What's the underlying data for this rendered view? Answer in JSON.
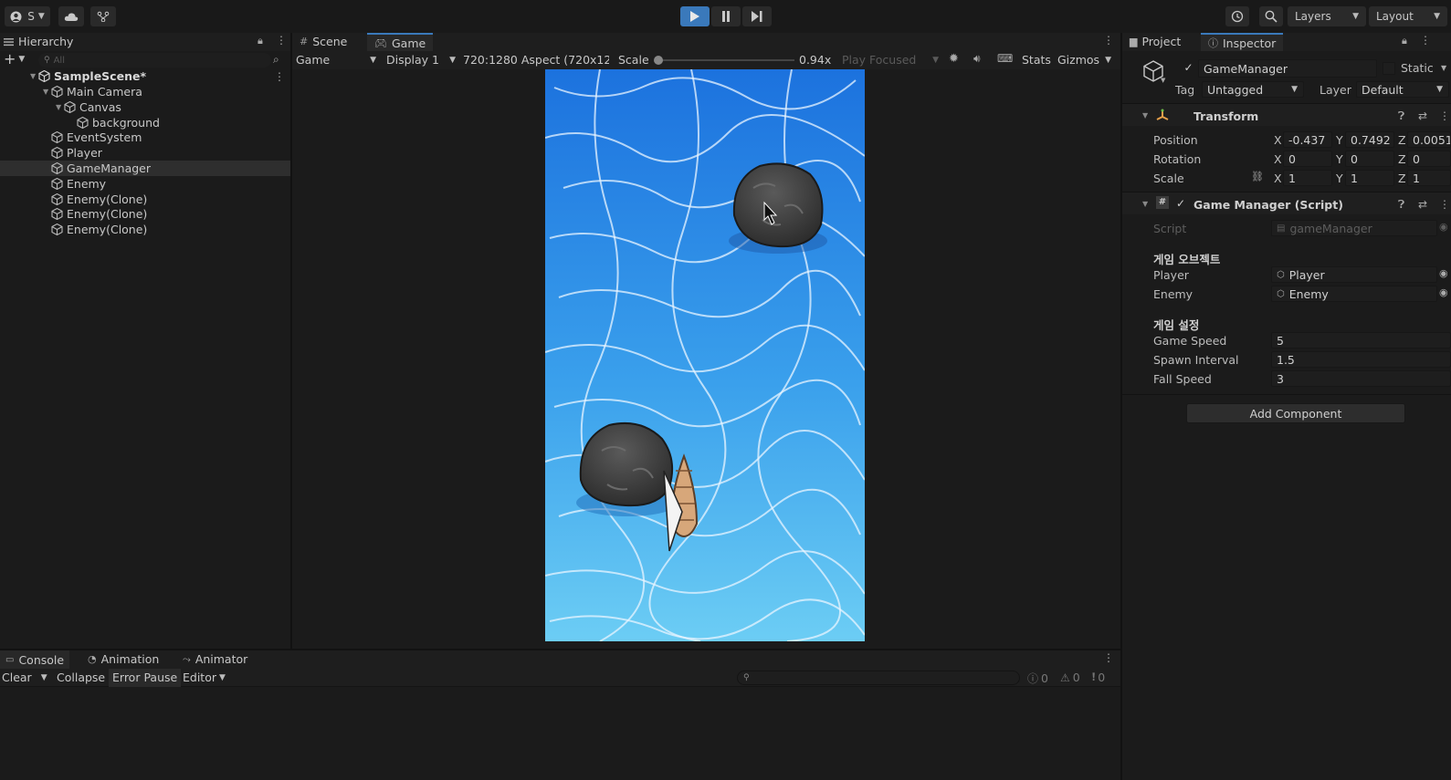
{
  "toolbar": {
    "account_label": "S",
    "layers_label": "Layers",
    "layout_label": "Layout",
    "play_color": "#3a79bb"
  },
  "hierarchy": {
    "tab_label": "Hierarchy",
    "search_placeholder": "All",
    "scene_name": "SampleScene*",
    "items": [
      {
        "label": "Main Camera",
        "indent": 1,
        "expanded": true
      },
      {
        "label": "Canvas",
        "indent": 2,
        "expanded": true
      },
      {
        "label": "background",
        "indent": 3
      },
      {
        "label": "EventSystem",
        "indent": 1
      },
      {
        "label": "Player",
        "indent": 1
      },
      {
        "label": "GameManager",
        "indent": 1,
        "selected": true
      },
      {
        "label": "Enemy",
        "indent": 1
      },
      {
        "label": "Enemy(Clone)",
        "indent": 1
      },
      {
        "label": "Enemy(Clone)",
        "indent": 1
      },
      {
        "label": "Enemy(Clone)",
        "indent": 1
      }
    ]
  },
  "center": {
    "tabs": [
      {
        "label": "Scene",
        "active": false
      },
      {
        "label": "Game",
        "active": true
      }
    ],
    "game_dropdown": "Game",
    "display_dropdown": "Display 1",
    "aspect_dropdown": "720:1280 Aspect (720x12",
    "scale_label": "Scale",
    "scale_value": "0.94x",
    "play_focused": "Play Focused",
    "stats_label": "Stats",
    "gizmos_label": "Gizmos"
  },
  "inspector": {
    "tabs": [
      {
        "label": "Project"
      },
      {
        "label": "Inspector"
      }
    ],
    "object_name": "GameManager",
    "static_label": "Static",
    "tag_label": "Tag",
    "tag_value": "Untagged",
    "layer_label": "Layer",
    "layer_value": "Default",
    "transform": {
      "title": "Transform",
      "position_label": "Position",
      "rotation_label": "Rotation",
      "scale_label": "Scale",
      "position": {
        "x": "-0.437",
        "y": "0.7492",
        "z": "0.0051"
      },
      "rotation": {
        "x": "0",
        "y": "0",
        "z": "0"
      },
      "scale": {
        "x": "1",
        "y": "1",
        "z": "1"
      }
    },
    "script_component": {
      "title": "Game Manager (Script)",
      "script_label": "Script",
      "script_value": "gameManager",
      "section1_header": "게임 오브젝트",
      "player_label": "Player",
      "player_value": "Player",
      "enemy_label": "Enemy",
      "enemy_value": "Enemy",
      "section2_header": "게임 설정",
      "game_speed_label": "Game Speed",
      "game_speed_value": "5",
      "spawn_interval_label": "Spawn Interval",
      "spawn_interval_value": "1.5",
      "fall_speed_label": "Fall Speed",
      "fall_speed_value": "3"
    },
    "add_component_label": "Add Component"
  },
  "console": {
    "tabs": [
      {
        "label": "Console"
      },
      {
        "label": "Animation"
      },
      {
        "label": "Animator"
      }
    ],
    "clear_label": "Clear",
    "collapse_label": "Collapse",
    "error_pause_label": "Error Pause",
    "editor_label": "Editor",
    "log_count": "0",
    "warning_count": "0",
    "error_count": "0"
  }
}
